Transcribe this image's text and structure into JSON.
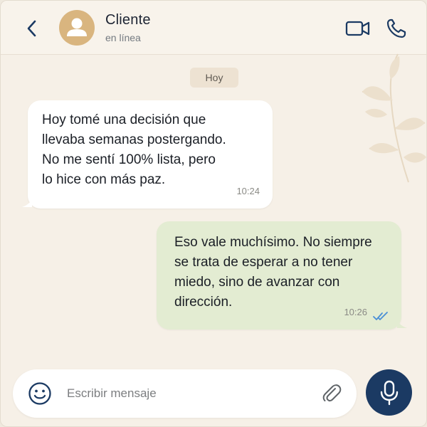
{
  "header": {
    "back_icon": "chevron-left-icon",
    "avatar_icon": "person-icon",
    "contact_name": "Cliente",
    "status": "en línea",
    "video_icon": "video-camera-icon",
    "call_icon": "phone-icon"
  },
  "chat": {
    "date_label": "Hoy",
    "messages": [
      {
        "direction": "incoming",
        "lines": [
          "Hoy tomé una decisión que",
          "llevaba semanas postergando.",
          "No me sentí 100% lista, pero",
          "lo hice con más paz."
        ],
        "time": "10:24"
      },
      {
        "direction": "outgoing",
        "lines": [
          "Eso vale muchísimo. No siempre",
          "se trata de esperar a no tener",
          "miedo, sino de avanzar con",
          "dirección."
        ],
        "time": "10:26",
        "status_icon": "double-check-icon",
        "status": "read"
      }
    ]
  },
  "composer": {
    "emoji_icon": "smiley-icon",
    "placeholder": "Escribir mensaje",
    "value": "",
    "attach_icon": "paperclip-icon",
    "mic_icon": "microphone-icon"
  },
  "colors": {
    "accent": "#1b3a63",
    "background": "#f6f0e7",
    "incoming_bubble": "#ffffff",
    "outgoing_bubble": "#e3ecd2",
    "avatar": "#d9b57f",
    "read_check": "#4a8fd6"
  }
}
